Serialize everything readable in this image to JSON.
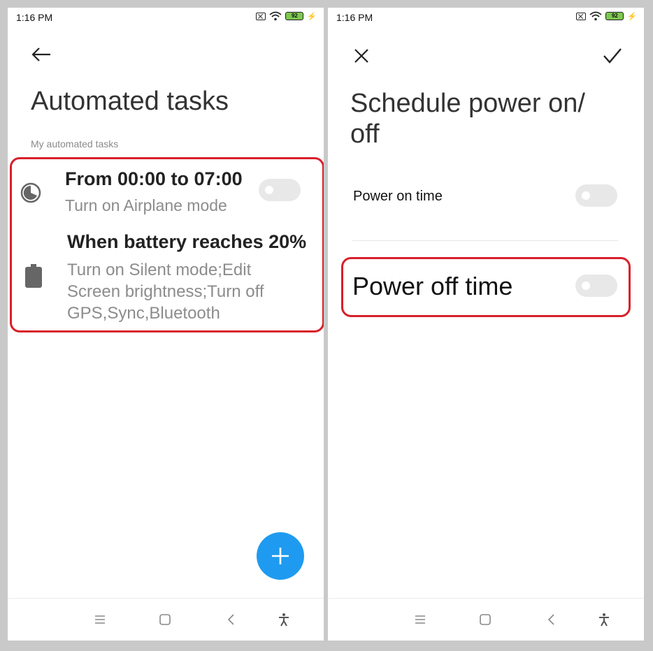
{
  "left_screen": {
    "status": {
      "time": "1:16 PM",
      "battery": "92"
    },
    "title": "Automated tasks",
    "section_label": "My automated tasks",
    "tasks": [
      {
        "title": "From 00:00 to 07:00",
        "subtitle": "Turn on Airplane mode",
        "icon": "clock-icon",
        "toggle_on": false
      },
      {
        "title": "When battery reaches 20%",
        "subtitle_lines": [
          "Turn on Silent mode;Edit",
          "Screen brightness;Turn off",
          "GPS,Sync,Bluetooth"
        ],
        "icon": "battery-icon"
      }
    ],
    "fab_label": "+"
  },
  "right_screen": {
    "status": {
      "time": "1:16 PM",
      "battery": "92"
    },
    "title_lines": [
      "Schedule power on/",
      "off"
    ],
    "settings": [
      {
        "label": "Power on time",
        "toggle_on": false
      },
      {
        "label": "Power off time",
        "toggle_on": false
      }
    ]
  },
  "colors": {
    "highlight": "#d8202a",
    "fab": "#1e9bf0",
    "toggle_off": "#e8e8e8",
    "battery_fill": "#7ec850"
  },
  "navbar_icons": [
    "menu-icon",
    "home-icon",
    "back-icon",
    "accessibility-icon"
  ]
}
